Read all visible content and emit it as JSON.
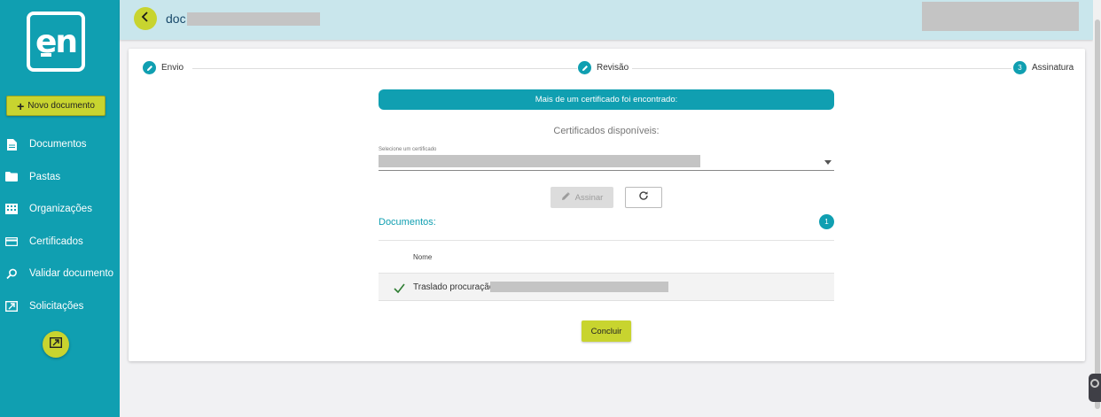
{
  "app": {
    "logo_text": "en"
  },
  "sidebar": {
    "new_doc_label": "Novo documento",
    "items": [
      {
        "label": "Documentos",
        "icon": "document-icon"
      },
      {
        "label": "Pastas",
        "icon": "folder-icon"
      },
      {
        "label": "Organizações",
        "icon": "building-icon"
      },
      {
        "label": "Certificados",
        "icon": "card-icon"
      },
      {
        "label": "Validar documento",
        "icon": "search-icon"
      },
      {
        "label": "Solicitações",
        "icon": "request-icon"
      }
    ]
  },
  "header": {
    "title": "doc"
  },
  "stepper": {
    "steps": [
      {
        "label": "Envio",
        "state": "done"
      },
      {
        "label": "Revisão",
        "state": "done"
      },
      {
        "label": "Assinatura",
        "number": "3",
        "state": "active"
      }
    ]
  },
  "signing": {
    "banner": "Mais de um certificado foi encontrado:",
    "heading": "Certificados disponíveis:",
    "select_label": "Selecione um certificado",
    "sign_label": "Assinar"
  },
  "documents": {
    "label": "Documentos:",
    "count": "1",
    "column_name": "Nome",
    "rows": [
      {
        "name": "Traslado procuração"
      }
    ]
  },
  "actions": {
    "conclude_label": "Concluir"
  },
  "colors": {
    "primary": "#109fb1",
    "accent": "#c8d42f",
    "header_bg": "#c9e6ec"
  }
}
